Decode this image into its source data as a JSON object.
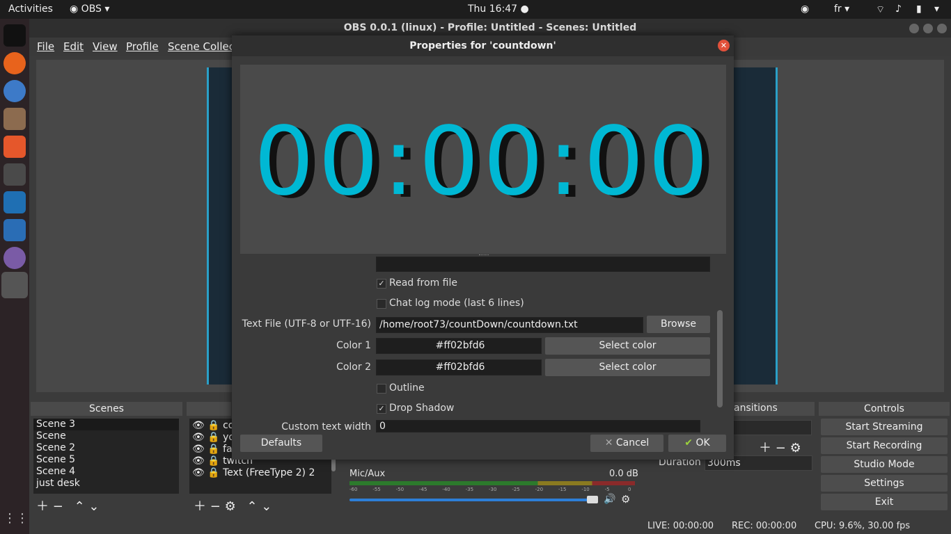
{
  "topbar": {
    "activities": "Activities",
    "app": "OBS",
    "clock": "Thu 16:47 ●",
    "lang": "fr"
  },
  "window": {
    "title": "OBS 0.0.1 (linux) - Profile: Untitled - Scenes: Untitled"
  },
  "menu": [
    "File",
    "Edit",
    "View",
    "Profile",
    "Scene Collecti"
  ],
  "scenes": {
    "title": "Scenes",
    "items": [
      "Scene 3",
      "Scene",
      "Scene 2",
      "Scene 5",
      "Scene 4",
      "just desk"
    ]
  },
  "sources": {
    "items": [
      "cou",
      "you",
      "fac",
      "twitch",
      "Text (FreeType 2) 2"
    ]
  },
  "mixer": {
    "channel": "Mic/Aux",
    "level": "0.0 dB",
    "ticks": [
      "-60",
      "-55",
      "-50",
      "-45",
      "-40",
      "-35",
      "-30",
      "-25",
      "-20",
      "-15",
      "-10",
      "-5",
      "0"
    ]
  },
  "transitions": {
    "title": "ansitions",
    "duration_label": "Duration",
    "duration_value": "300ms"
  },
  "controls": {
    "title": "Controls",
    "buttons": [
      "Start Streaming",
      "Start Recording",
      "Studio Mode",
      "Settings",
      "Exit"
    ]
  },
  "status": {
    "live": "LIVE: 00:00:00",
    "rec": "REC: 00:00:00",
    "cpu": "CPU: 9.6%, 30.00 fps"
  },
  "dialog": {
    "title": "Properties for 'countdown'",
    "clock_text": "00:00:00",
    "read_from_file": "Read from file",
    "chat_log": "Chat log mode (last 6 lines)",
    "text_file_label": "Text File (UTF-8 or UTF-16)",
    "text_file_value": "/home/root73/countDown/countdown.txt",
    "browse": "Browse",
    "color1_label": "Color 1",
    "color1_value": "#ff02bfd6",
    "color2_label": "Color 2",
    "color2_value": "#ff02bfd6",
    "select_color": "Select color",
    "outline": "Outline",
    "drop_shadow": "Drop Shadow",
    "custom_width_label": "Custom text width",
    "custom_width_value": "0",
    "defaults": "Defaults",
    "cancel": "Cancel",
    "ok": "OK",
    "check_mark": "✓"
  },
  "colors": {
    "accent": "#00b8d4",
    "close": "#e2513b"
  }
}
